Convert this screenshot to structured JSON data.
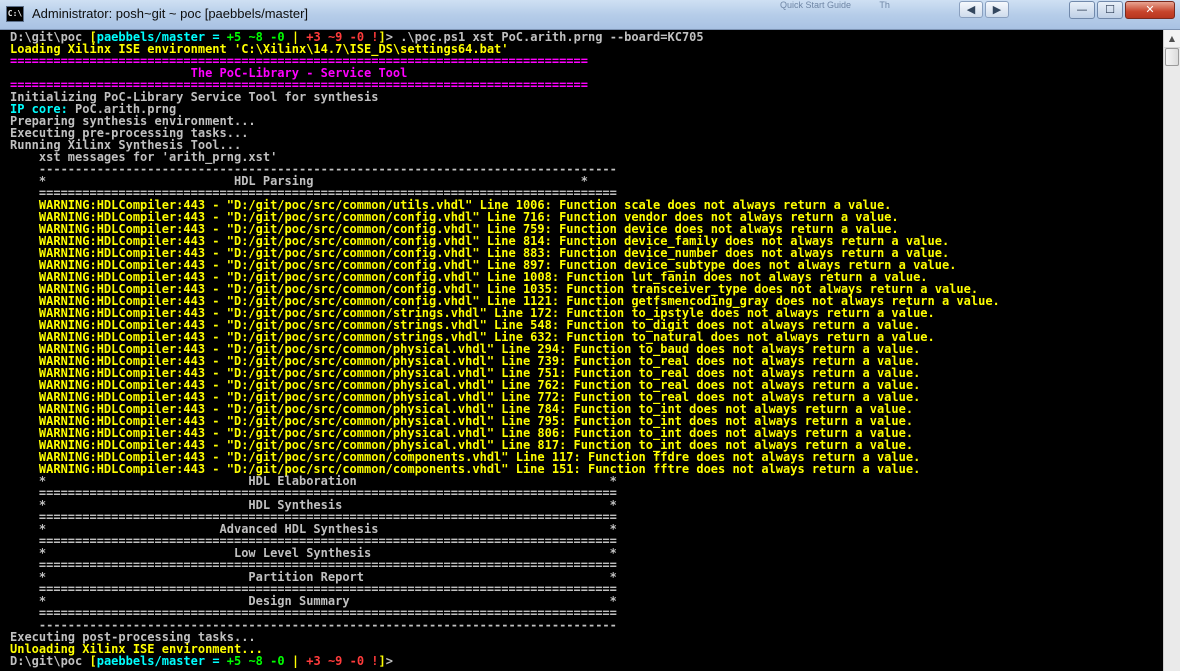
{
  "window": {
    "title": "Administrator: posh~git ~ poc [paebbels/master]",
    "icon": "console-icon",
    "background_tab_labels": [
      "Quick Start Guide",
      "Th"
    ],
    "nav_back_icon": "back-arrow-icon",
    "nav_forward_icon": "forward-arrow-icon",
    "minimize_glyph": "—",
    "maximize_glyph": "☐",
    "close_glyph": "✕"
  },
  "colors": {
    "background": "#000000",
    "default_text": "#c0c0c0",
    "yellow": "#ffff00",
    "magenta": "#ff00ff",
    "cyan": "#00ffff",
    "green": "#00ff00",
    "red": "#ff3b3b"
  },
  "console": {
    "lines": [
      [
        {
          "t": "D:\\git\\poc ",
          "c": "gray"
        },
        {
          "t": "[",
          "c": "yellow"
        },
        {
          "t": "paebbels/master",
          "c": "cyan"
        },
        {
          "t": " = ",
          "c": "cyan"
        },
        {
          "t": "+5 ~8 -0 ",
          "c": "green"
        },
        {
          "t": "| ",
          "c": "yellow"
        },
        {
          "t": "+3 ~9 -0 !",
          "c": "red"
        },
        {
          "t": "]",
          "c": "yellow"
        },
        {
          "t": "> .\\poc.ps1 xst PoC.arith.prng --board=KC705",
          "c": "gray"
        }
      ],
      [
        {
          "t": "Loading Xilinx ISE environment 'C:\\Xilinx\\14.7\\ISE_DS\\settings64.bat'",
          "c": "yellow"
        }
      ],
      [
        {
          "t": "================================================================================",
          "c": "magenta"
        }
      ],
      [
        {
          "t": "                         The PoC-Library - Service Tool",
          "c": "magenta"
        }
      ],
      [
        {
          "t": "================================================================================",
          "c": "magenta"
        }
      ],
      [
        {
          "t": "Initializing PoC-Library Service Tool for synthesis",
          "c": "gray"
        }
      ],
      [
        {
          "t": "IP core: ",
          "c": "cyan"
        },
        {
          "t": "PoC.arith.prng",
          "c": "gray"
        }
      ],
      [
        {
          "t": "Preparing synthesis environment...",
          "c": "gray"
        }
      ],
      [
        {
          "t": "Executing pre-processing tasks...",
          "c": "gray"
        }
      ],
      [
        {
          "t": "Running Xilinx Synthesis Tool...",
          "c": "gray"
        }
      ],
      [
        {
          "t": "    xst messages for 'arith_prng.xst'",
          "c": "gray"
        }
      ],
      [
        {
          "t": "    --------------------------------------------------------------------------------",
          "c": "gray"
        }
      ],
      [
        {
          "t": "    *                          HDL Parsing                                     *",
          "c": "gray"
        }
      ],
      [
        {
          "t": "    ================================================================================",
          "c": "gray"
        }
      ],
      [
        {
          "t": "    WARNING:HDLCompiler:443 - \"D:/git/poc/src/common/utils.vhdl\" Line 1006: Function scale does not always return a value.",
          "c": "yellow"
        }
      ],
      [
        {
          "t": "    WARNING:HDLCompiler:443 - \"D:/git/poc/src/common/config.vhdl\" Line 716: Function vendor does not always return a value.",
          "c": "yellow"
        }
      ],
      [
        {
          "t": "    WARNING:HDLCompiler:443 - \"D:/git/poc/src/common/config.vhdl\" Line 759: Function device does not always return a value.",
          "c": "yellow"
        }
      ],
      [
        {
          "t": "    WARNING:HDLCompiler:443 - \"D:/git/poc/src/common/config.vhdl\" Line 814: Function device_family does not always return a value.",
          "c": "yellow"
        }
      ],
      [
        {
          "t": "    WARNING:HDLCompiler:443 - \"D:/git/poc/src/common/config.vhdl\" Line 883: Function device_number does not always return a value.",
          "c": "yellow"
        }
      ],
      [
        {
          "t": "    WARNING:HDLCompiler:443 - \"D:/git/poc/src/common/config.vhdl\" Line 897: Function device_subtype does not always return a value.",
          "c": "yellow"
        }
      ],
      [
        {
          "t": "    WARNING:HDLCompiler:443 - \"D:/git/poc/src/common/config.vhdl\" Line 1008: Function lut_fanin does not always return a value.",
          "c": "yellow"
        }
      ],
      [
        {
          "t": "    WARNING:HDLCompiler:443 - \"D:/git/poc/src/common/config.vhdl\" Line 1035: Function transceiver_type does not always return a value.",
          "c": "yellow"
        }
      ],
      [
        {
          "t": "    WARNING:HDLCompiler:443 - \"D:/git/poc/src/common/config.vhdl\" Line 1121: Function getfsmencoding_gray does not always return a value.",
          "c": "yellow"
        }
      ],
      [
        {
          "t": "    WARNING:HDLCompiler:443 - \"D:/git/poc/src/common/strings.vhdl\" Line 172: Function to_ipstyle does not always return a value.",
          "c": "yellow"
        }
      ],
      [
        {
          "t": "    WARNING:HDLCompiler:443 - \"D:/git/poc/src/common/strings.vhdl\" Line 548: Function to_digit does not always return a value.",
          "c": "yellow"
        }
      ],
      [
        {
          "t": "    WARNING:HDLCompiler:443 - \"D:/git/poc/src/common/strings.vhdl\" Line 632: Function to_natural does not always return a value.",
          "c": "yellow"
        }
      ],
      [
        {
          "t": "    WARNING:HDLCompiler:443 - \"D:/git/poc/src/common/physical.vhdl\" Line 294: Function to_baud does not always return a value.",
          "c": "yellow"
        }
      ],
      [
        {
          "t": "    WARNING:HDLCompiler:443 - \"D:/git/poc/src/common/physical.vhdl\" Line 739: Function to_real does not always return a value.",
          "c": "yellow"
        }
      ],
      [
        {
          "t": "    WARNING:HDLCompiler:443 - \"D:/git/poc/src/common/physical.vhdl\" Line 751: Function to_real does not always return a value.",
          "c": "yellow"
        }
      ],
      [
        {
          "t": "    WARNING:HDLCompiler:443 - \"D:/git/poc/src/common/physical.vhdl\" Line 762: Function to_real does not always return a value.",
          "c": "yellow"
        }
      ],
      [
        {
          "t": "    WARNING:HDLCompiler:443 - \"D:/git/poc/src/common/physical.vhdl\" Line 772: Function to_real does not always return a value.",
          "c": "yellow"
        }
      ],
      [
        {
          "t": "    WARNING:HDLCompiler:443 - \"D:/git/poc/src/common/physical.vhdl\" Line 784: Function to_int does not always return a value.",
          "c": "yellow"
        }
      ],
      [
        {
          "t": "    WARNING:HDLCompiler:443 - \"D:/git/poc/src/common/physical.vhdl\" Line 795: Function to_int does not always return a value.",
          "c": "yellow"
        }
      ],
      [
        {
          "t": "    WARNING:HDLCompiler:443 - \"D:/git/poc/src/common/physical.vhdl\" Line 806: Function to_int does not always return a value.",
          "c": "yellow"
        }
      ],
      [
        {
          "t": "    WARNING:HDLCompiler:443 - \"D:/git/poc/src/common/physical.vhdl\" Line 817: Function to_int does not always return a value.",
          "c": "yellow"
        }
      ],
      [
        {
          "t": "    WARNING:HDLCompiler:443 - \"D:/git/poc/src/common/components.vhdl\" Line 117: Function ffdre does not always return a value.",
          "c": "yellow"
        }
      ],
      [
        {
          "t": "    WARNING:HDLCompiler:443 - \"D:/git/poc/src/common/components.vhdl\" Line 151: Function fftre does not always return a value.",
          "c": "yellow"
        }
      ],
      [
        {
          "t": "    *                            HDL Elaboration                                   *",
          "c": "gray"
        }
      ],
      [
        {
          "t": "    ================================================================================",
          "c": "gray"
        }
      ],
      [
        {
          "t": "    *                            HDL Synthesis                                     *",
          "c": "gray"
        }
      ],
      [
        {
          "t": "    ================================================================================",
          "c": "gray"
        }
      ],
      [
        {
          "t": "    *                        Advanced HDL Synthesis                                *",
          "c": "gray"
        }
      ],
      [
        {
          "t": "    ================================================================================",
          "c": "gray"
        }
      ],
      [
        {
          "t": "    *                          Low Level Synthesis                                 *",
          "c": "gray"
        }
      ],
      [
        {
          "t": "    ================================================================================",
          "c": "gray"
        }
      ],
      [
        {
          "t": "    *                            Partition Report                                  *",
          "c": "gray"
        }
      ],
      [
        {
          "t": "    ================================================================================",
          "c": "gray"
        }
      ],
      [
        {
          "t": "    *                            Design Summary                                    *",
          "c": "gray"
        }
      ],
      [
        {
          "t": "    ================================================================================",
          "c": "gray"
        }
      ],
      [
        {
          "t": "    --------------------------------------------------------------------------------",
          "c": "gray"
        }
      ],
      [
        {
          "t": "Executing post-processing tasks...",
          "c": "gray"
        }
      ],
      [
        {
          "t": "Unloading Xilinx ISE environment...",
          "c": "yellow"
        }
      ],
      [
        {
          "t": "D:\\git\\poc ",
          "c": "gray"
        },
        {
          "t": "[",
          "c": "yellow"
        },
        {
          "t": "paebbels/master",
          "c": "cyan"
        },
        {
          "t": " = ",
          "c": "cyan"
        },
        {
          "t": "+5 ~8 -0 ",
          "c": "green"
        },
        {
          "t": "| ",
          "c": "yellow"
        },
        {
          "t": "+3 ~9 -0 !",
          "c": "red"
        },
        {
          "t": "]",
          "c": "yellow"
        },
        {
          "t": ">",
          "c": "gray"
        }
      ]
    ]
  }
}
